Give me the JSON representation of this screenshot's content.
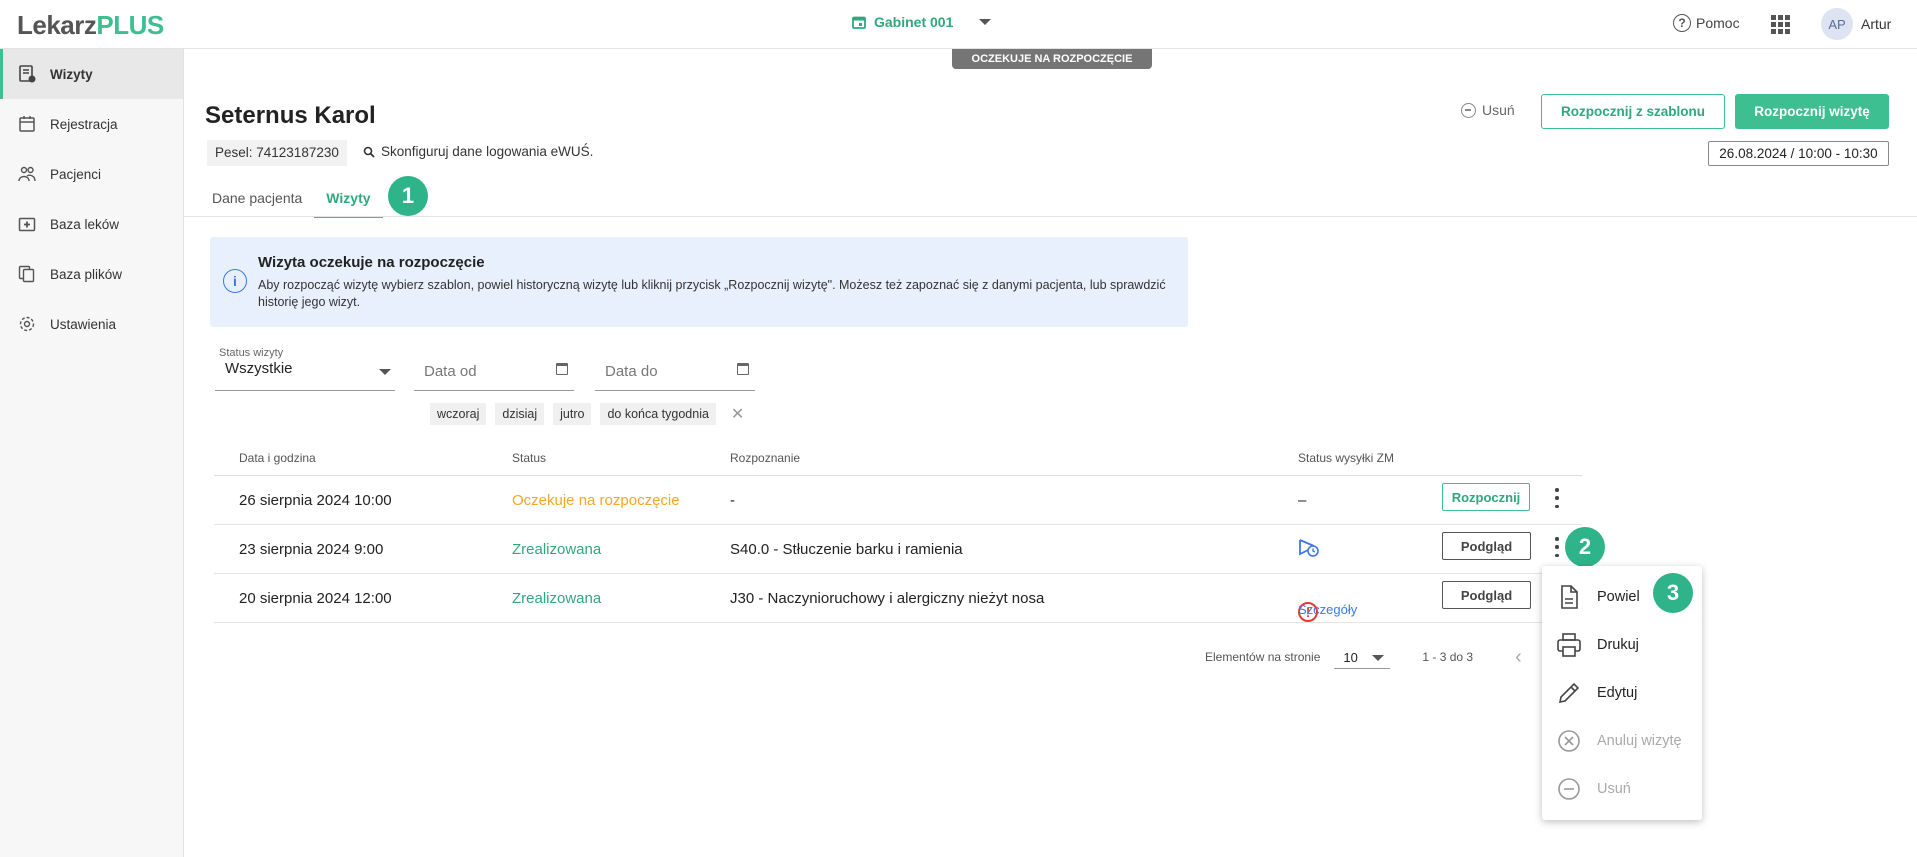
{
  "app": {
    "logo_a": "Lekarz",
    "logo_b": "PLUS"
  },
  "header": {
    "cabinet": "Gabinet 001",
    "help": "Pomoc",
    "avatar_initials": "AP",
    "user_name": "Artur"
  },
  "sidebar": {
    "items": [
      {
        "label": "Wizyty",
        "icon": "visits-icon",
        "active": true
      },
      {
        "label": "Rejestracja",
        "icon": "calendar-icon"
      },
      {
        "label": "Pacjenci",
        "icon": "patients-icon"
      },
      {
        "label": "Baza leków",
        "icon": "medicine-icon"
      },
      {
        "label": "Baza plików",
        "icon": "files-icon"
      },
      {
        "label": "Ustawienia",
        "icon": "gear-icon"
      }
    ]
  },
  "visit_status_banner": "OCZEKUJE NA ROZPOCZĘCIE",
  "patient": {
    "name": "Seternus Karol",
    "pesel": "Pesel: 74123187230",
    "ewus": "Skonfiguruj dane logowania eWUŚ."
  },
  "actions": {
    "delete": "Usuń",
    "start_template": "Rozpocznij z szablonu",
    "start_visit": "Rozpocznij wizytę",
    "date": "26.08.2024 / 10:00 - 10:30"
  },
  "tabs": [
    {
      "label": "Dane pacjenta"
    },
    {
      "label": "Wizyty",
      "active": true
    }
  ],
  "steps": [
    "1",
    "2",
    "3"
  ],
  "info": {
    "title": "Wizyta oczekuje na rozpoczęcie",
    "text": "Aby rozpocząć wizytę wybierz szablon, powiel historyczną wizytę lub kliknij przycisk „Rozpocznij wizytę\". Możesz też zapoznać się z danymi pacjenta, lub sprawdzić historię jego wizyt."
  },
  "filters": {
    "status_label": "Status wizyty",
    "status_value": "Wszystkie",
    "date_from": "Data od",
    "date_to": "Data do",
    "chips": [
      "wczoraj",
      "dzisiaj",
      "jutro",
      "do końca tygodnia"
    ]
  },
  "table": {
    "headers": [
      "Data i godzina",
      "Status",
      "Rozpoznanie",
      "Status wysyłki ZM"
    ],
    "rows": [
      {
        "date": "26 sierpnia 2024 10:00",
        "status": "Oczekuje na rozpoczęcie",
        "diagnosis": "-",
        "zm": "–",
        "action": "Rozpocznij"
      },
      {
        "date": "23 sierpnia 2024 9:00",
        "status": "Zrealizowana",
        "diagnosis": "S40.0 - Stłuczenie barku i ramienia",
        "zm_icon": "pending-send-icon",
        "action": "Podgląd"
      },
      {
        "date": "20 sierpnia 2024 12:00",
        "status": "Zrealizowana",
        "diagnosis": "J30 - Naczynioruchowy i alergiczny nieżyt nosa",
        "zm": "Szczegóły",
        "action": "Podgląd"
      }
    ]
  },
  "pagination": {
    "label": "Elementów na stronie",
    "per_page": "10",
    "range": "1 - 3 do 3"
  },
  "context_menu": [
    {
      "label": "Powiel",
      "icon": "document-icon"
    },
    {
      "label": "Drukuj",
      "icon": "printer-icon"
    },
    {
      "label": "Edytuj",
      "icon": "pencil-icon"
    },
    {
      "label": "Anuluj wizytę",
      "icon": "cancel-circle-icon",
      "disabled": true
    },
    {
      "label": "Usuń",
      "icon": "minus-circle-icon",
      "disabled": true
    }
  ]
}
